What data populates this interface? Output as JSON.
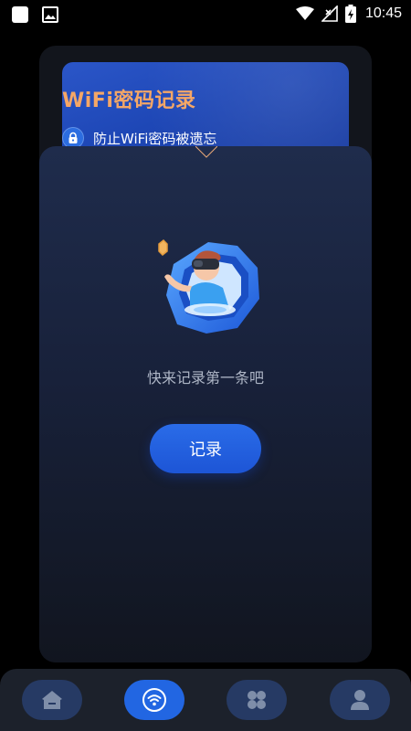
{
  "status_bar": {
    "time": "10:45",
    "left_icons": [
      "app-notification-icon",
      "image-icon"
    ],
    "right_icons": [
      "wifi-icon",
      "no-signal-icon",
      "battery-charging-icon"
    ]
  },
  "banner": {
    "title": "WiFi密码记录",
    "subtitle": "防止WiFi密码被遗忘",
    "icon": "lock-icon"
  },
  "empty_state": {
    "message": "快来记录第一条吧",
    "illustration": "vr-character-illustration"
  },
  "actions": {
    "record_label": "记录"
  },
  "bottom_nav": {
    "items": [
      {
        "icon": "home-icon",
        "active": false
      },
      {
        "icon": "wifi-icon",
        "active": true
      },
      {
        "icon": "apps-icon",
        "active": false
      },
      {
        "icon": "person-icon",
        "active": false
      }
    ]
  },
  "colors": {
    "accent": "#2266e2",
    "title_orange": "#f5a766",
    "banner_blue": "#1e47b6",
    "card_bg": "#1a2440"
  }
}
